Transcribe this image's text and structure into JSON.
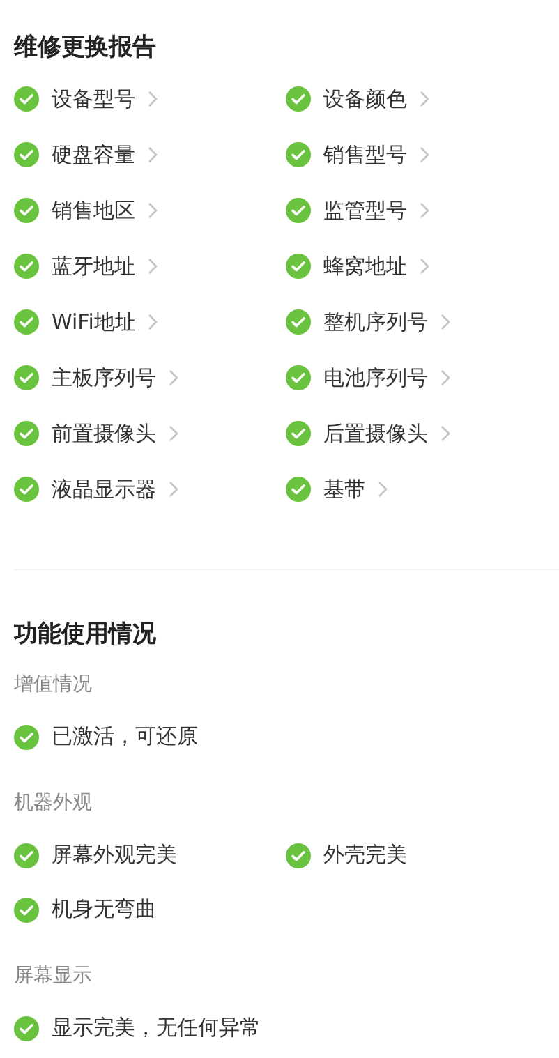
{
  "report": {
    "title": "维修更换报告",
    "items": [
      {
        "label": "设备型号",
        "expandable": true
      },
      {
        "label": "设备颜色",
        "expandable": true
      },
      {
        "label": "硬盘容量",
        "expandable": true
      },
      {
        "label": "销售型号",
        "expandable": true
      },
      {
        "label": "销售地区",
        "expandable": true
      },
      {
        "label": "监管型号",
        "expandable": true
      },
      {
        "label": "蓝牙地址",
        "expandable": true
      },
      {
        "label": "蜂窝地址",
        "expandable": true
      },
      {
        "label": "WiFi地址",
        "expandable": true
      },
      {
        "label": "整机序列号",
        "expandable": true
      },
      {
        "label": "主板序列号",
        "expandable": true
      },
      {
        "label": "电池序列号",
        "expandable": true
      },
      {
        "label": "前置摄像头",
        "expandable": true
      },
      {
        "label": "后置摄像头",
        "expandable": true
      },
      {
        "label": "液晶显示器",
        "expandable": true
      },
      {
        "label": "基带",
        "expandable": true
      }
    ]
  },
  "usage": {
    "title": "功能使用情况",
    "groups": [
      {
        "title": "增值情况",
        "items": [
          {
            "label": "已激活，可还原"
          }
        ]
      },
      {
        "title": "机器外观",
        "items": [
          {
            "label": "屏幕外观完美"
          },
          {
            "label": "外壳完美"
          },
          {
            "label": "机身无弯曲"
          }
        ]
      },
      {
        "title": "屏幕显示",
        "items": [
          {
            "label": "显示完美，无任何异常"
          }
        ]
      }
    ]
  }
}
